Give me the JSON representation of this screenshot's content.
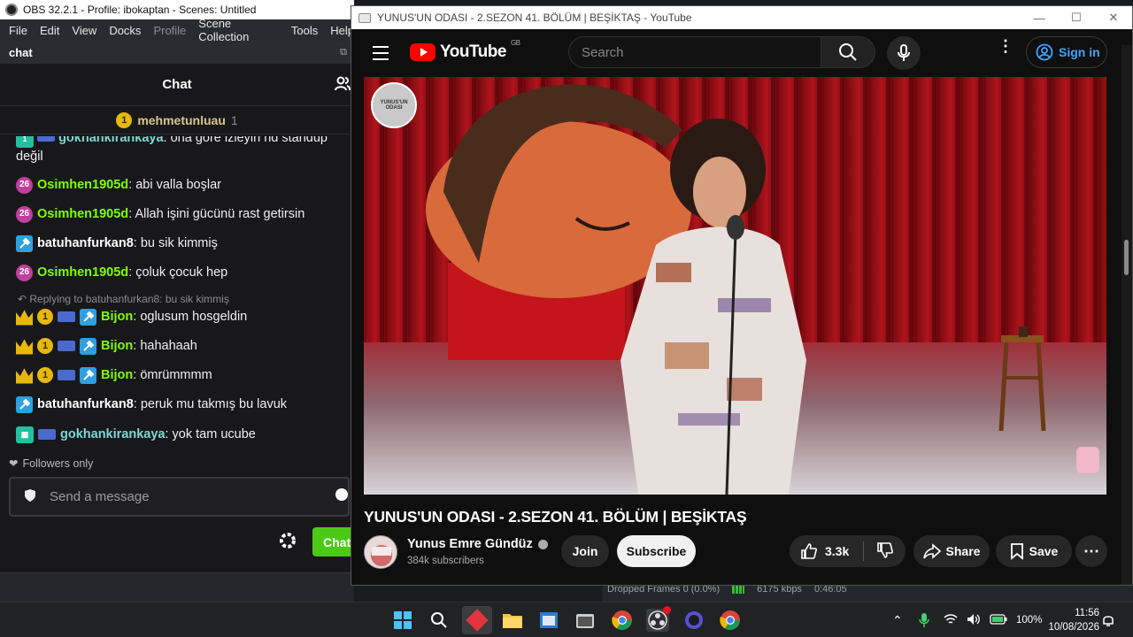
{
  "obs": {
    "title": "OBS 32.2.1 - Profile: ibokaptan - Scenes: Untitled",
    "menu": [
      "File",
      "Edit",
      "View",
      "Docks",
      "Profile",
      "Scene Collection",
      "Tools",
      "Help"
    ],
    "dock_title": "chat"
  },
  "chat": {
    "header": "Chat",
    "pinned_user": "mehmetunluau",
    "pinned_count": "1",
    "messages": [
      {
        "user": "gokhankirankaya",
        "user_color": "#7dd7d5",
        "text": "ona göre izleyin nd standup değil"
      },
      {
        "user": "Osimhen1905d",
        "user_color": "#7fff00",
        "text": "abi valla boşlar"
      },
      {
        "user": "Osimhen1905d",
        "user_color": "#7fff00",
        "text": "Allah işini gücünü rast getirsin"
      },
      {
        "user": "batuhanfurkan8",
        "user_color": "#ffffff",
        "text": "bu sik kimmiş"
      },
      {
        "user": "Osimhen1905d",
        "user_color": "#7fff00",
        "text": "çoluk çocuk hep"
      },
      {
        "user": "Bijon",
        "user_color": "#7fff00",
        "text": "oglusum hosgeldin"
      },
      {
        "user": "Bijon",
        "user_color": "#7fff00",
        "text": "hahahaah"
      },
      {
        "user": "Bijon",
        "user_color": "#7fff00",
        "text": "ömrümmmm"
      },
      {
        "user": "batuhanfurkan8",
        "user_color": "#ffffff",
        "text": "peruk mu takmış bu lavuk"
      },
      {
        "user": "gokhankirankaya",
        "user_color": "#7dd7d5",
        "text": "yok tam ucube"
      }
    ],
    "reply_context": "Replying to batuhanfurkan8: bu sik kimmiş",
    "followers_only": "Followers only",
    "input_placeholder": "Send a message",
    "chat_button": "Chat",
    "badge_sub_months": "26",
    "badge_gift_count": "1"
  },
  "obs_status": {
    "dropped_frames": "Dropped Frames 0 (0.0%)",
    "bitrate": "6175 kbps",
    "time": "0:46:05"
  },
  "youtube": {
    "window_title": "YUNUS'UN ODASI - 2.SEZON 41. BÖLÜM | BEŞİKTAŞ - YouTube",
    "logo_text": "YouTube",
    "region": "GB",
    "search_placeholder": "Search",
    "sign_in": "Sign in",
    "channel_bug": "YUNUS'UN ODASI",
    "video_title": "YUNUS'UN ODASI - 2.SEZON 41. BÖLÜM | BEŞİKTAŞ",
    "channel_name": "Yunus Emre Gündüz",
    "subscribers": "384k subscribers",
    "join": "Join",
    "subscribe": "Subscribe",
    "likes": "3.3k",
    "share": "Share",
    "save": "Save"
  },
  "taskbar": {
    "battery": "100%",
    "time": "11:56",
    "date": "10/08/2026"
  },
  "colors": {
    "youtube_red": "#ff0000",
    "twitch_green": "#4aca14",
    "sign_in_blue": "#3ea6ff",
    "gold_badge": "#e5b80b"
  }
}
